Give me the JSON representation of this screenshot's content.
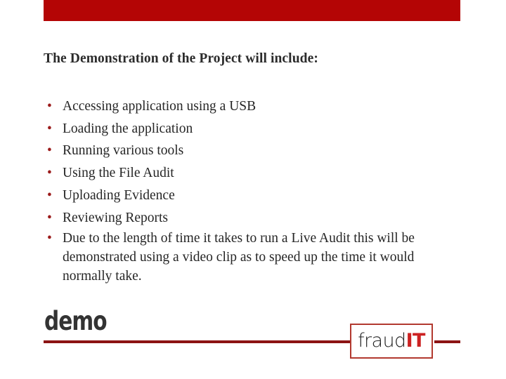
{
  "slide": {
    "title": "The Demonstration of the Project will include:",
    "bullets": [
      "Accessing application using a USB",
      "Loading the application",
      "Running various tools",
      "Using the File Audit",
      "Uploading Evidence",
      "Reviewing Reports",
      "Due to the length of time it takes to run a Live Audit this will be demonstrated using a video clip as to speed up the time it would normally take."
    ],
    "bullet_marker": "•",
    "demo_label": "demo",
    "logo": {
      "text_primary": "fraud",
      "text_accent": "IT"
    },
    "colors": {
      "banner_red": "#b40505",
      "rule_red": "#8c1414",
      "bullet_red": "#9b1b1b",
      "logo_border": "#b2392f",
      "logo_accent": "#cc2222",
      "title_text": "#2b2b2b",
      "body_text": "#262626",
      "demo_text": "#333333",
      "background": "#ffffff"
    }
  }
}
